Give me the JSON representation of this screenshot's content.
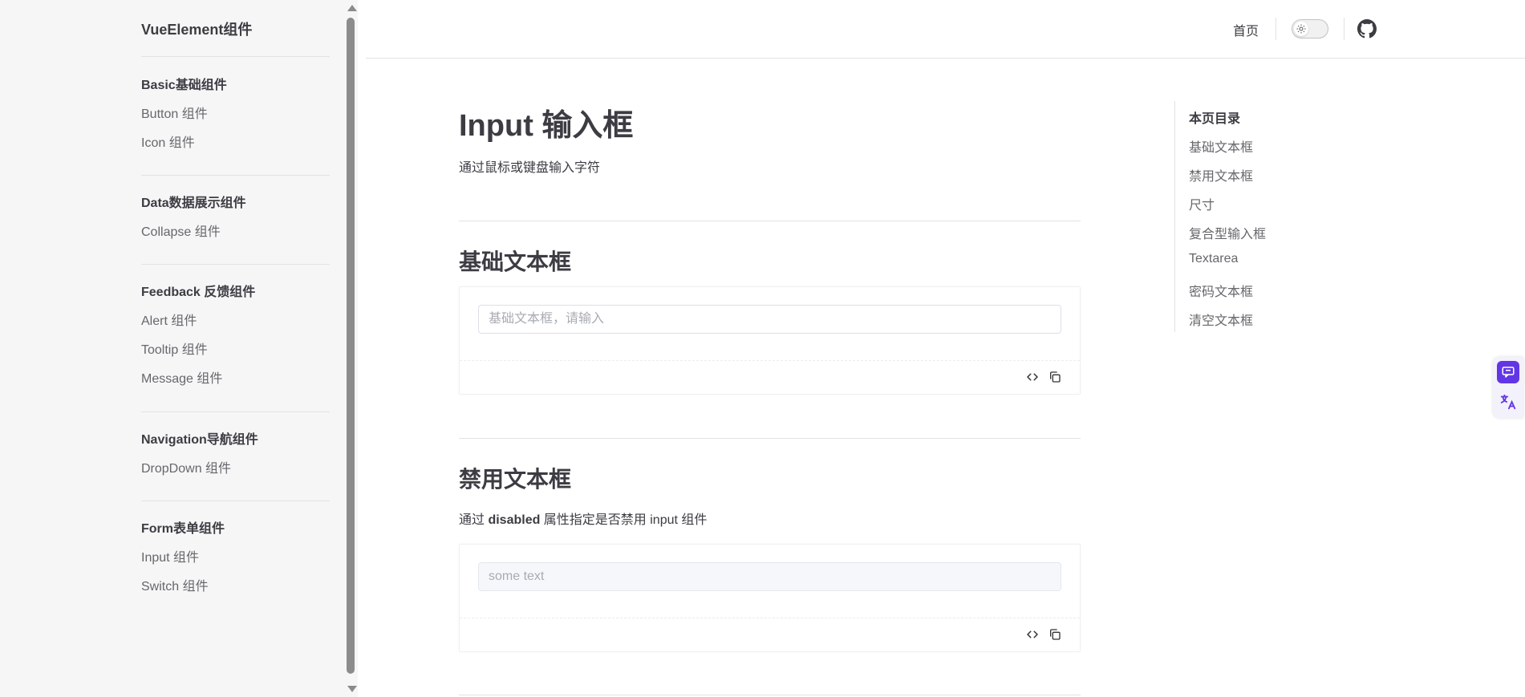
{
  "sidebar": {
    "title": "VueElement组件",
    "groups": [
      {
        "title": "Basic基础组件",
        "items": [
          "Button 组件",
          "Icon 组件"
        ]
      },
      {
        "title": "Data数据展示组件",
        "items": [
          "Collapse 组件"
        ]
      },
      {
        "title": "Feedback 反馈组件",
        "items": [
          "Alert 组件",
          "Tooltip 组件",
          "Message 组件"
        ]
      },
      {
        "title": "Navigation导航组件",
        "items": [
          "DropDown 组件"
        ]
      },
      {
        "title": "Form表单组件",
        "items": [
          "Input 组件",
          "Switch 组件"
        ]
      }
    ]
  },
  "nav": {
    "home": "首页",
    "theme_icon": "sun-icon",
    "github_icon": "github-icon"
  },
  "main": {
    "title": "Input 输入框",
    "description": "通过鼠标或键盘输入字符",
    "sections": [
      {
        "heading": "基础文本框",
        "input_placeholder": "基础文本框，请输入",
        "input_value": ""
      },
      {
        "heading": "禁用文本框",
        "desc_prefix": "通过 ",
        "desc_bold": "disabled",
        "desc_suffix": " 属性指定是否禁用 input 组件",
        "input_placeholder": "some text",
        "input_value": ""
      }
    ],
    "tools": {
      "code_icon": "code-icon",
      "copy_icon": "copy-icon"
    }
  },
  "toc": {
    "title": "本页目录",
    "items": [
      "基础文本框",
      "禁用文本框",
      "尺寸",
      "复合型输入框",
      "Textarea",
      "密码文本框",
      "清空文本框"
    ]
  },
  "colors": {
    "accent": "#6236e5",
    "sidebar_bg": "#f6f6f7",
    "text": "#3c3c43",
    "muted": "#67676c"
  }
}
